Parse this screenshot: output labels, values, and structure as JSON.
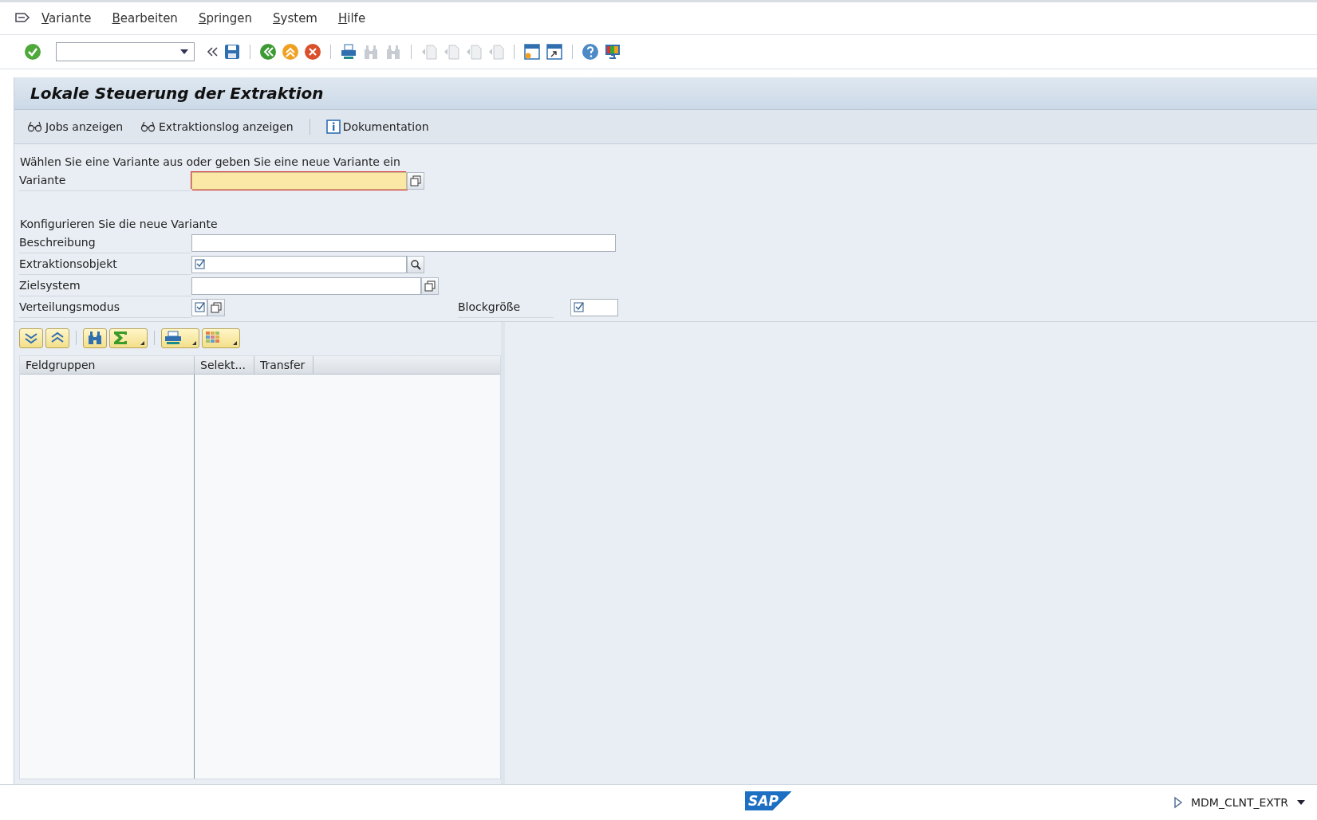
{
  "menu": [
    "Variante",
    "Bearbeiten",
    "Springen",
    "System",
    "Hilfe"
  ],
  "title": "Lokale Steuerung der Extraktion",
  "app_toolbar": [
    {
      "label": "Jobs anzeigen",
      "kind": "glasses"
    },
    {
      "label": "Extraktionslog anzeigen",
      "kind": "glasses"
    },
    {
      "label": "Dokumentation",
      "kind": "info"
    }
  ],
  "select_section": {
    "heading": "Wählen Sie eine Variante aus oder geben Sie eine neue Variante ein",
    "fields": [
      {
        "label": "Variante",
        "kind": "required",
        "help": true
      }
    ]
  },
  "config_section": {
    "heading": "Konfigurieren Sie die neue Variante",
    "fields": [
      {
        "label": "Beschreibung",
        "kind": "long"
      },
      {
        "label": "Extraktionsobjekt",
        "kind": "check",
        "search": true
      },
      {
        "label": "Zielsystem",
        "kind": "plain",
        "help": true
      },
      {
        "label": "Verteilungsmodus",
        "kind": "check-short",
        "help": true
      }
    ],
    "side_field": {
      "label": "Blockgröße",
      "kind": "check"
    }
  },
  "table": {
    "columns": [
      "Feldgruppen",
      "Selekt...",
      "Transfer"
    ]
  },
  "status_bar": {
    "logo": "SAP",
    "system": "MDM_CLNT_EXTR"
  }
}
